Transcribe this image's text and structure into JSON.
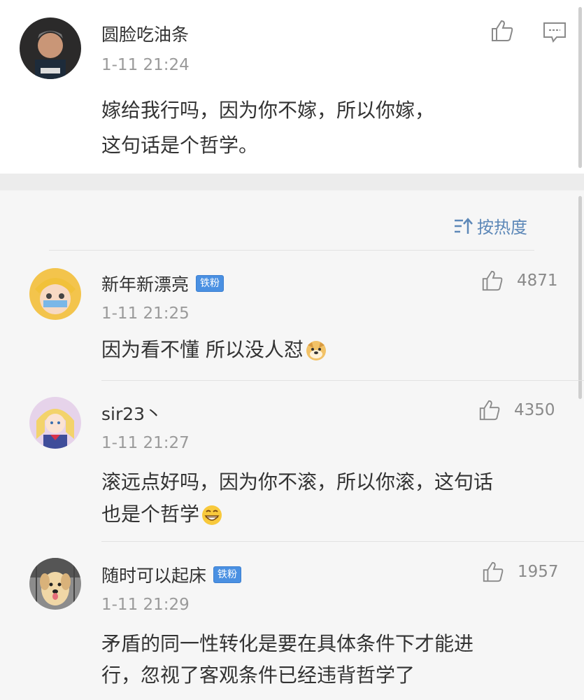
{
  "post": {
    "username": "圆脸吃油条",
    "time": "1-11 21:24",
    "text_line1": "嫁给我行吗，因为你不嫁，所以你嫁，",
    "text_line2": "这句话是个哲学。"
  },
  "sort": {
    "label": "按热度"
  },
  "badge_text": "铁粉",
  "comments": [
    {
      "username": "新年新漂亮",
      "badge": "铁粉",
      "time": "1-11 21:25",
      "likes": "4871",
      "text_line1": "因为看不懂 所以没人怼",
      "emoji": "doge-icon"
    },
    {
      "username": "sir23丶",
      "time": "1-11 21:27",
      "likes": "4350",
      "text_line1": "滚远点好吗，因为你不滚，所以你滚，这句话",
      "text_line2": "也是个哲学",
      "emoji": "grin-icon"
    },
    {
      "username": "随时可以起床",
      "badge": "铁粉",
      "time": "1-11 21:29",
      "likes": "1957",
      "text_line1": "矛盾的同一性转化是要在具体条件下才能进",
      "text_line2": "行，忽视了客观条件已经违背哲学了"
    }
  ],
  "colors": {
    "badge": "#4a90e2",
    "sort_text": "#5d88b8",
    "background": "#f6f6f6"
  }
}
